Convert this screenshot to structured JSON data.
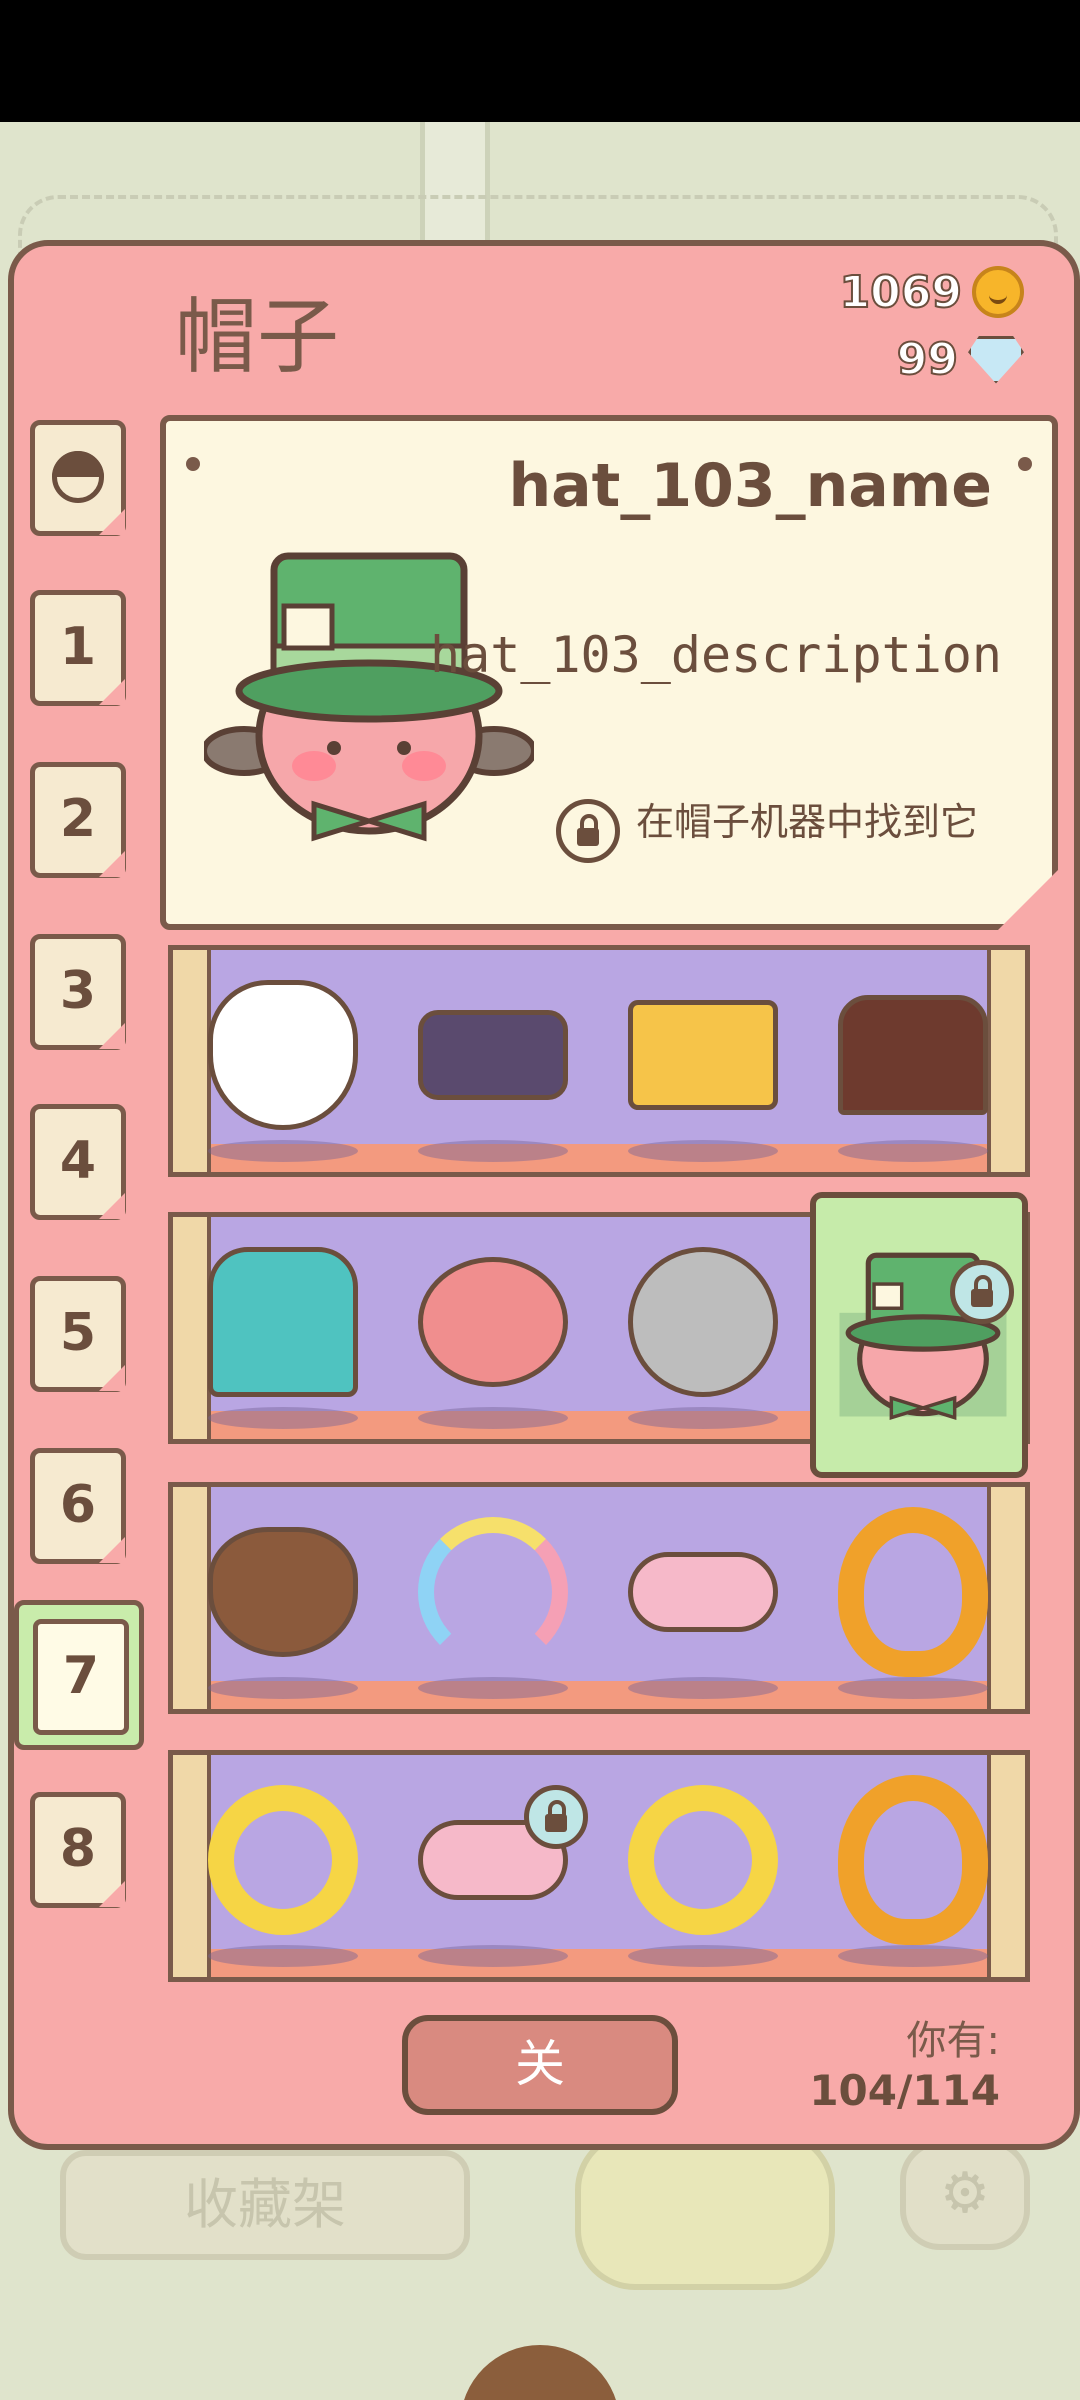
{
  "background": {
    "shelf_button_label": "收藏架",
    "settings_icon": "gear-icon"
  },
  "modal": {
    "title": "帽子",
    "coins": "1069",
    "gems": "99",
    "tabs": [
      {
        "label": "",
        "icon": "face-icon"
      },
      {
        "label": "1"
      },
      {
        "label": "2"
      },
      {
        "label": "3"
      },
      {
        "label": "4"
      },
      {
        "label": "5"
      },
      {
        "label": "6"
      },
      {
        "label": "7",
        "active": true
      },
      {
        "label": "8"
      }
    ],
    "info": {
      "name": "hat_103_name",
      "description": "hat_103_description",
      "unlock_hint": "在帽子机器中找到它"
    },
    "shelves": [
      {
        "items": [
          "fox-mask-hat",
          "ninja-mask-hat",
          "snake-pharaoh-hat",
          "cobra-headdress-hat"
        ]
      },
      {
        "items": [
          "anubis-headdress-hat",
          "pilot-helmet-hat",
          "knight-helmet-hat",
          "mad-hatter-hat"
        ],
        "selected_index": 3
      },
      {
        "items": [
          "bunny-hood-hat",
          "rainbow-hat",
          "cherry-blossom-crown-hat",
          "golden-egg-ring-hat"
        ]
      },
      {
        "items": [
          "chick-hood-hat",
          "cherry-blossom-crown-hat",
          "chick-hood-hat",
          "golden-egg-ring-hat"
        ],
        "locked_index": 1
      }
    ],
    "close_label": "关",
    "you_have_label": "你有:",
    "collection_count": "104/114",
    "colors": {
      "panel": "#f8aaa9",
      "outline": "#7a5a4a",
      "shelf_back": "#b9a6e3",
      "selected": "#c6ebaa"
    }
  }
}
